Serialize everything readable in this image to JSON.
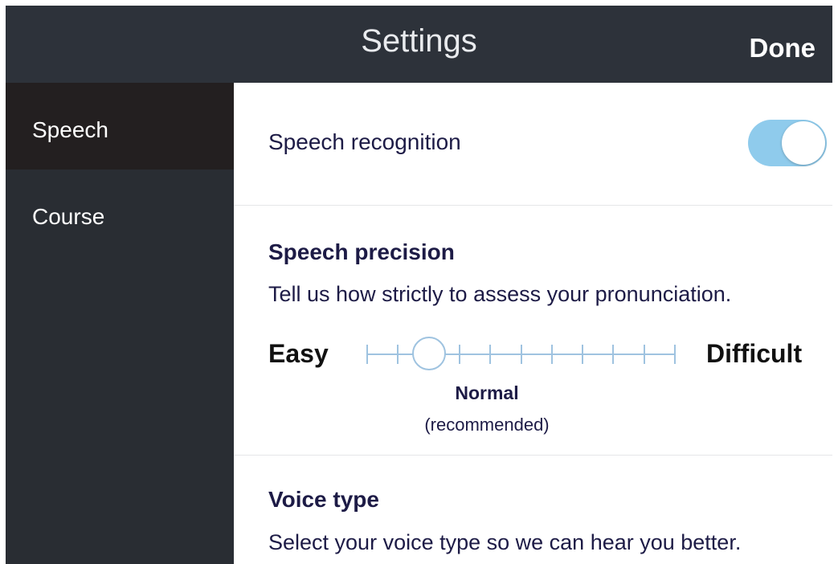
{
  "header": {
    "title": "Settings",
    "done_label": "Done"
  },
  "sidebar": {
    "items": [
      {
        "label": "Speech",
        "selected": true
      },
      {
        "label": "Course",
        "selected": false
      }
    ]
  },
  "speech_recognition": {
    "label": "Speech recognition",
    "enabled": true
  },
  "speech_precision": {
    "title": "Speech precision",
    "description": "Tell us how strictly to assess your pronunciation.",
    "min_label": "Easy",
    "max_label": "Difficult",
    "steps": 11,
    "selected_step": 2,
    "selected_label": "Normal",
    "selected_note": "(recommended)"
  },
  "voice_type": {
    "title": "Voice type",
    "description": "Select your voice type so we can hear you better."
  },
  "colors": {
    "header_bg": "#2d323a",
    "sidebar_bg": "#292d33",
    "sidebar_selected_bg": "#231f20",
    "toggle_on": "#8fcbec",
    "slider_track": "#9fc3e0",
    "text_dark": "#1d1b46"
  },
  "icons": {
    "toggle": "toggle-switch-icon",
    "slider_thumb": "slider-thumb-icon"
  }
}
